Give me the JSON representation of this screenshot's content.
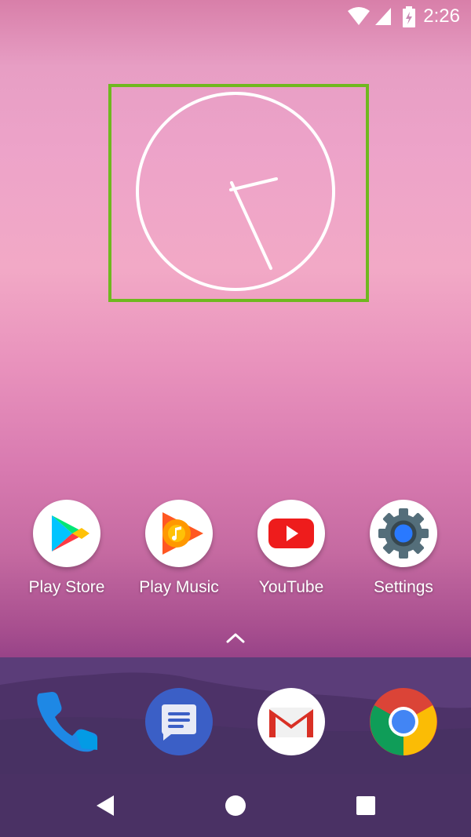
{
  "status_bar": {
    "time": "2:26",
    "icons": [
      "wifi-icon",
      "cell-signal-icon",
      "battery-charging-icon"
    ]
  },
  "clock_widget": {
    "type": "analog-clock",
    "highlight_color": "#6fb81f"
  },
  "home_apps": [
    {
      "label": "Play Store",
      "icon": "play-store-icon"
    },
    {
      "label": "Play Music",
      "icon": "play-music-icon"
    },
    {
      "label": "YouTube",
      "icon": "youtube-icon"
    },
    {
      "label": "Settings",
      "icon": "settings-icon"
    }
  ],
  "app_drawer": {
    "icon": "chevron-up-icon"
  },
  "dock": [
    {
      "icon": "phone-icon"
    },
    {
      "icon": "messages-icon"
    },
    {
      "icon": "gmail-icon"
    },
    {
      "icon": "chrome-icon"
    }
  ],
  "nav_bar": {
    "buttons": [
      "back-icon",
      "home-icon",
      "recents-icon"
    ]
  },
  "colors": {
    "widget_highlight": "#6fb81f",
    "dock_bg": "#5b3d79",
    "nav_bg": "#4a3164"
  }
}
